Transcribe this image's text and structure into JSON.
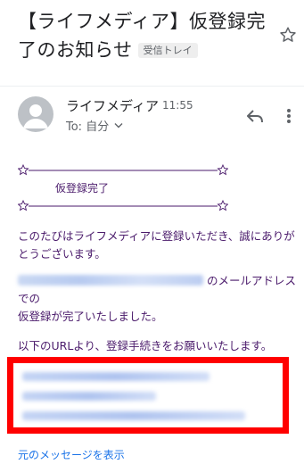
{
  "email": {
    "subject": "【ライフメディア】仮登録完了のお知らせ",
    "folder_badge": "受信トレイ",
    "sender": {
      "name": "ライフメディア",
      "time": "11:55",
      "to": "To: 自分"
    },
    "body": {
      "title": "仮登録完了",
      "para1": "このたびはライフメディアに登録いただき、誠にありがとうございます。",
      "email_suffix": "のメールアドレスでの",
      "para2_line2": "仮登録が完了いたしました。",
      "para3": "以下のURLより、登録手続きをお願いいたします。"
    },
    "show_original": "元のメッセージを表示"
  },
  "colors": {
    "body_text": "#4a1a6b",
    "link": "#1a73e8",
    "highlight_box": "#ff0000"
  },
  "icons": [
    "star-icon",
    "avatar-icon",
    "chevron-down-icon",
    "reply-icon",
    "more-vert-icon"
  ]
}
